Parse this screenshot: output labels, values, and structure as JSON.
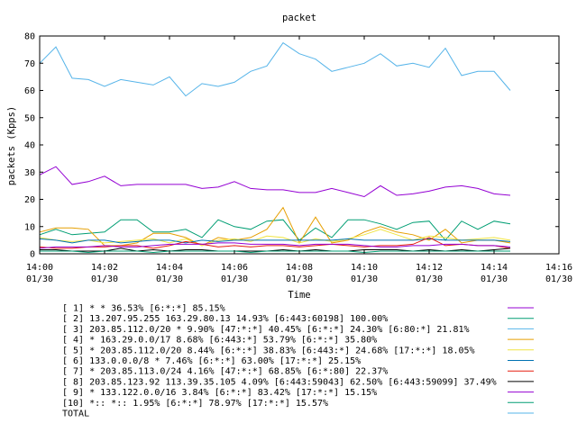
{
  "chart_data": {
    "type": "line",
    "title": "packet",
    "xlabel": "Time",
    "ylabel": "packets (Kpps)",
    "ylim": [
      0,
      80
    ],
    "xlim_minutes": [
      0,
      16
    ],
    "y_ticks": [
      "0",
      "10",
      "20",
      "30",
      "40",
      "50",
      "60",
      "70",
      "80"
    ],
    "x_ticks": [
      {
        "time": "14:00",
        "date": "01/30"
      },
      {
        "time": "14:02",
        "date": "01/30"
      },
      {
        "time": "14:04",
        "date": "01/30"
      },
      {
        "time": "14:06",
        "date": "01/30"
      },
      {
        "time": "14:08",
        "date": "01/30"
      },
      {
        "time": "14:10",
        "date": "01/30"
      },
      {
        "time": "14:12",
        "date": "01/30"
      },
      {
        "time": "14:14",
        "date": "01/30"
      },
      {
        "time": "14:16",
        "date": "01/30"
      }
    ],
    "x_minutes": [
      0,
      0.5,
      1,
      1.5,
      2,
      2.5,
      3,
      3.5,
      4,
      4.5,
      5,
      5.5,
      6,
      6.5,
      7,
      7.5,
      8,
      8.5,
      9,
      9.5,
      10,
      10.5,
      11,
      11.5,
      12,
      12.5,
      13,
      13.5,
      14,
      14.5
    ],
    "grid": false,
    "legend_position": "bottom",
    "series": [
      {
        "name": "[ 1] * * 36.53%  [6:*:*] 85.15%",
        "color": "#9400d3",
        "values": [
          29,
          32,
          25.5,
          26.5,
          28.5,
          25,
          25.5,
          25.5,
          25.5,
          25.5,
          24,
          24.5,
          26.5,
          24,
          23.5,
          23.5,
          22.5,
          22.5,
          24,
          22.5,
          21,
          25,
          21.5,
          22,
          23,
          24.5,
          25,
          24,
          22,
          21.5
        ]
      },
      {
        "name": "[ 2] 13.207.95.255 163.29.80.13 14.93%  [6:443:60198] 100.00%",
        "color": "#009e73",
        "values": [
          7,
          9,
          7,
          7.5,
          8,
          12.5,
          12.5,
          8,
          8,
          9,
          6,
          12.5,
          10,
          9,
          12,
          12.5,
          5,
          9.5,
          6,
          12.5,
          12.5,
          11,
          9,
          11.5,
          12,
          5,
          12,
          9,
          12,
          11
        ]
      },
      {
        "name": "[ 3] 203.85.112.0/20 * 9.90%  [47:*:*] 40.45% [6:*:*] 24.30% [6:80:*] 21.81%",
        "color": "#56b4e9",
        "values": [
          70,
          76,
          64.5,
          64,
          61.5,
          64,
          63,
          62,
          65,
          58,
          62.5,
          61.5,
          63,
          67,
          69,
          77.5,
          73.5,
          71.5,
          67,
          68.5,
          70,
          73.5,
          69,
          70,
          68.5,
          75.5,
          65.5,
          67,
          67,
          60
        ]
      },
      {
        "name": "[ 4] * 163.29.0.0/17 8.68%  [6:443:*] 53.79% [6:*:*] 35.80%",
        "color": "#e69f00",
        "values": [
          8,
          9.5,
          9.5,
          9,
          3,
          3,
          4,
          7.5,
          7.5,
          6,
          3,
          6,
          5,
          6,
          9,
          17,
          4,
          13.5,
          4,
          5,
          8,
          10,
          8,
          7,
          5,
          9,
          4,
          5,
          5,
          4
        ]
      },
      {
        "name": "[ 5] * 203.85.112.0/20 8.44%  [6:*:*] 38.83% [6:443:*] 24.68% [17:*:*] 18.05%",
        "color": "#f0e442",
        "values": [
          6,
          5,
          4.5,
          5,
          4,
          4.5,
          5,
          5.5,
          4,
          5.5,
          3,
          5,
          5.5,
          4.5,
          6.5,
          6,
          4,
          5.5,
          4.5,
          5.5,
          7,
          9,
          7,
          5,
          6.5,
          6,
          5,
          5.5,
          6,
          5
        ]
      },
      {
        "name": "[ 6] 133.0.0.0/8 * 7.46%  [6:*:*] 63.00% [17:*:*] 25.15%",
        "color": "#0072b2",
        "values": [
          5.5,
          5,
          4,
          5,
          5,
          4,
          4.5,
          5,
          5,
          4,
          5,
          4.5,
          5,
          5,
          5,
          5,
          5,
          5,
          5,
          5.5,
          5,
          5,
          5,
          5,
          5.5,
          5,
          5,
          5,
          5,
          4.5
        ]
      },
      {
        "name": "[ 7] * 203.85.113.0/24 4.16%  [47:*:*] 68.85% [6:*:80] 22.37%",
        "color": "#e51e10",
        "values": [
          2.5,
          2,
          2,
          2.5,
          2.5,
          3,
          3,
          2,
          3,
          4.5,
          3.5,
          2.5,
          3,
          2.5,
          3,
          3,
          2.5,
          3,
          3.5,
          3,
          2.5,
          3,
          3,
          3.5,
          6,
          3,
          3.5,
          3,
          3,
          2
        ]
      },
      {
        "name": "[ 8] 203.85.123.92 113.39.35.105 4.09%  [6:443:59043] 62.50% [6:443:59099] 37.49%",
        "color": "#000000",
        "values": [
          1.5,
          1.5,
          1,
          1,
          1,
          2,
          1,
          1.5,
          1,
          1.5,
          1.5,
          1,
          1,
          1,
          1,
          1.5,
          1,
          1.5,
          1,
          1,
          1.5,
          1.5,
          1.5,
          1,
          1.5,
          1,
          1.5,
          1,
          1.5,
          2
        ]
      },
      {
        "name": "[ 9] * 133.122.0.0/16 3.84%  [6:*:*] 83.42% [17:*:*] 15.15%",
        "color": "#9400d3",
        "values": [
          2,
          2.5,
          2.5,
          2.5,
          3,
          2.5,
          2.5,
          3,
          3.5,
          3.5,
          3.5,
          4,
          4,
          3.5,
          3.5,
          3.5,
          3,
          3.5,
          3.5,
          3.5,
          3,
          2.5,
          2.5,
          3,
          3,
          3.5,
          3.5,
          3,
          3,
          2.5
        ]
      },
      {
        "name": "[10] *:: *:: 1.95%  [6:*:*] 78.97% [17:*:*] 15.57%",
        "color": "#009e73",
        "values": [
          1,
          1,
          1,
          0.5,
          1,
          1,
          1,
          0.5,
          1,
          1,
          1,
          1,
          1,
          0.5,
          1,
          1,
          1,
          1,
          1,
          1,
          0.5,
          1,
          1,
          1,
          1,
          1,
          1,
          1,
          1,
          1
        ]
      },
      {
        "name": "TOTAL",
        "color": "#56b4e9",
        "values": []
      }
    ]
  }
}
